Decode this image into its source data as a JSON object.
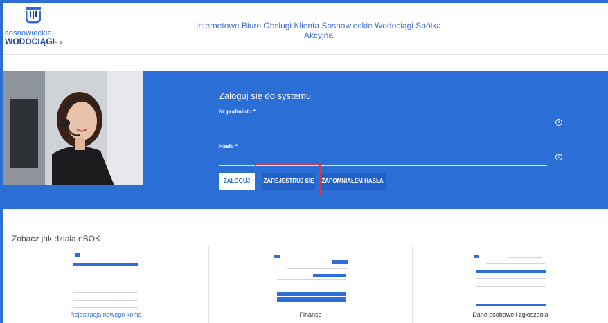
{
  "header": {
    "logo_line1": "sosnowieckie",
    "logo_line2": "WODOCIĄGI",
    "logo_suffix": "S.A.",
    "title": "Internetowe Biuro Obsługi Klienta Sosnowieckie Wodociągi Spółka Akcyjna"
  },
  "login": {
    "title": "Zaloguj się do systemu",
    "field_id_label": "Nr podmiotu *",
    "field_password_label": "Hasło *",
    "help_glyph": "?",
    "btn_login": "ZALOGUJ",
    "btn_register": "ZAREJESTRUJ SIĘ",
    "btn_forgot": "ZAPOMNIAŁEM HASŁA"
  },
  "showcase": {
    "title": "Zobacz jak działa eBOK",
    "cards": [
      {
        "label": "Rejestracja nowego konta",
        "color": "#2b6fd6"
      },
      {
        "label": "Finanse",
        "color": "#333333"
      },
      {
        "label": "Dane osobowe i zgłoszenia",
        "color": "#333333"
      }
    ]
  },
  "colors": {
    "brand_blue": "#2b6fd6",
    "highlight_red": "#d83a3a"
  }
}
